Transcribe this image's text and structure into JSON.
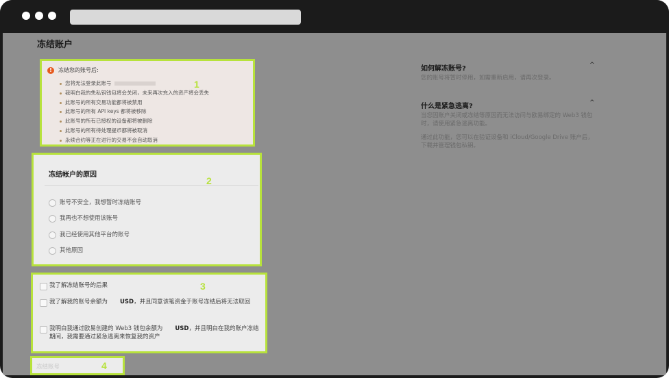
{
  "page_title": "冻结账户",
  "warning": {
    "title": "冻结您的账号后:",
    "items": [
      "您将无法登录此账号",
      "我明白我的免私钥钱包将会关闭，未来再次充入的资产将会丢失",
      "此账号的所有交易功能都将被禁用",
      "此账号的所有 API keys 都将被移除",
      "此账号的所有已授权的设备都将被删除",
      "此账号的所有待处理提币都将被取消",
      "永续合约等正在进行的交易不会自动取消"
    ]
  },
  "reasons": {
    "title": "冻结帐户的原因",
    "options": [
      "账号不安全，我想暂时冻结账号",
      "我再也不想使用该账号",
      "我已经使用其他平台的账号",
      "其他原因"
    ]
  },
  "confirmations": {
    "item1": "我了解冻结账号的后果",
    "item2_pre": "我了解我的账号余额为",
    "item2_unit": "USD",
    "item2_post": "，并且同意该笔资金于账号冻结后将无法取回",
    "item3_pre": "我明白我通过欧易创建的 Web3 钱包余额为",
    "item3_unit": "USD",
    "item3_post": "，并且明白在我的账户冻结期间，我需要通过紧急逃离来恢复我的资产"
  },
  "freeze_button": "冻结账号",
  "annotations": [
    "1",
    "2",
    "3",
    "4"
  ],
  "faq": [
    {
      "question": "如何解冻账号?",
      "answer": "您的账号将暂时停用，如需重新启用，请再次登录。"
    },
    {
      "question": "什么是紧急逃离?",
      "answer_p1": "当您因账户关闭或冻结等原因而无法访问与欧易绑定的 Web3 钱包时，请使用紧急逃离功能。",
      "answer_p2": "通过此功能，您可以在验证设备和 iCloud/Google Drive 账户后，下载并管理钱包私钥。"
    }
  ],
  "colors": {
    "highlight_border": "#b7e23c",
    "warning_icon": "#e65a1e",
    "overlay_gray": "#8e8e8e",
    "chrome": "#1b1b1b"
  }
}
